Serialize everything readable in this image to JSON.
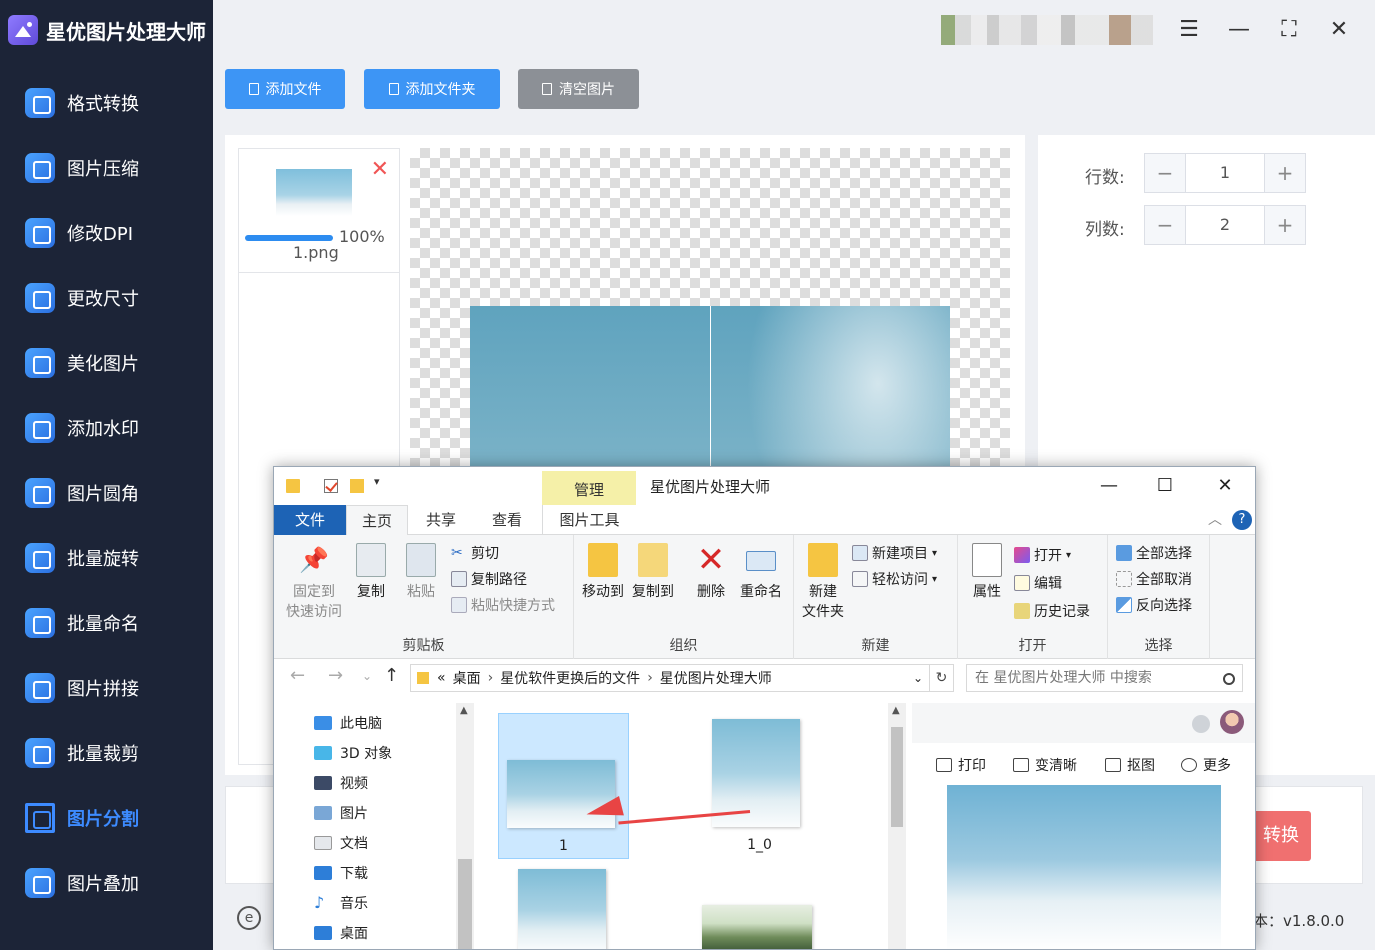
{
  "app": {
    "title": "星优图片处理大师",
    "version": "本：v1.8.0.0"
  },
  "sidebar": {
    "items": [
      {
        "label": "格式转换",
        "icon": "image-format-icon"
      },
      {
        "label": "图片压缩",
        "icon": "compress-icon"
      },
      {
        "label": "修改DPI",
        "icon": "dpi-icon"
      },
      {
        "label": "更改尺寸",
        "icon": "resize-icon"
      },
      {
        "label": "美化图片",
        "icon": "beautify-icon"
      },
      {
        "label": "添加水印",
        "icon": "watermark-icon"
      },
      {
        "label": "图片圆角",
        "icon": "rounded-corner-icon"
      },
      {
        "label": "批量旋转",
        "icon": "rotate-icon"
      },
      {
        "label": "批量命名",
        "icon": "rename-icon"
      },
      {
        "label": "图片拼接",
        "icon": "stitch-icon"
      },
      {
        "label": "批量裁剪",
        "icon": "crop-icon"
      },
      {
        "label": "图片分割",
        "icon": "split-icon",
        "active": true
      },
      {
        "label": "图片叠加",
        "icon": "layers-icon"
      }
    ]
  },
  "toolbar": {
    "add_file": "添加文件",
    "add_folder": "添加文件夹",
    "clear": "清空图片"
  },
  "file_list": {
    "items": [
      {
        "name": "1.png",
        "progress_text": "100%",
        "progress": 1.0
      }
    ]
  },
  "options": {
    "rows_label": "行数:",
    "rows_value": "1",
    "cols_label": "列数:",
    "cols_value": "2",
    "minus": "−",
    "plus": "+"
  },
  "convert_button": "转换",
  "explorer": {
    "title": "星优图片处理大师",
    "manage_tab": "管理",
    "tabs": [
      "文件",
      "主页",
      "共享",
      "查看",
      "图片工具"
    ],
    "ribbon": {
      "clipboard": {
        "title": "剪贴板",
        "pin": "固定到",
        "pin2": "快速访问",
        "copy": "复制",
        "paste": "粘贴",
        "cut": "剪切",
        "copy_path": "复制路径",
        "paste_shortcut": "粘贴快捷方式"
      },
      "organize": {
        "title": "组织",
        "move_to": "移动到",
        "copy_to": "复制到",
        "delete": "删除",
        "rename": "重命名"
      },
      "new": {
        "title": "新建",
        "new_folder": "新建",
        "new_folder2": "文件夹",
        "new_item": "新建项目",
        "easy_access": "轻松访问"
      },
      "open": {
        "title": "打开",
        "properties": "属性",
        "open": "打开",
        "edit": "编辑",
        "history": "历史记录"
      },
      "select": {
        "title": "选择",
        "select_all": "全部选择",
        "select_none": "全部取消",
        "invert": "反向选择"
      }
    },
    "address": {
      "prefix": "«",
      "crumbs": [
        "桌面",
        "星优软件更换后的文件",
        "星优图片处理大师"
      ],
      "search_placeholder": "在 星优图片处理大师 中搜索"
    },
    "nav_tree": [
      "此电脑",
      "3D 对象",
      "视频",
      "图片",
      "文档",
      "下载",
      "音乐",
      "桌面"
    ],
    "files": [
      {
        "name": "1",
        "selected": true
      },
      {
        "name": "1_0",
        "selected": false
      },
      {
        "name": "",
        "selected": false
      },
      {
        "name": "",
        "selected": false
      }
    ],
    "preview_actions": [
      "打印",
      "变清晰",
      "抠图",
      "更多"
    ]
  },
  "colors": {
    "sidebar_bg": "#1c2437",
    "accent": "#3d95f5",
    "active_nav": "#3d8bff",
    "convert": "#f07070",
    "explorer_file_tab": "#1d63b5",
    "manage_tab": "#f5f0a8"
  }
}
